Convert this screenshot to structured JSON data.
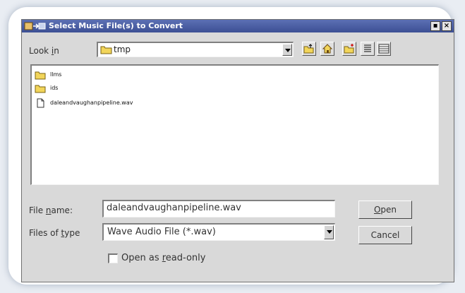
{
  "dialog": {
    "title": "Select Music File(s) to Convert",
    "title_buttons": [
      "▪",
      "×"
    ]
  },
  "look_in": {
    "label_pre": "Look ",
    "label_ul": "i",
    "label_post": "n",
    "value": "tmp"
  },
  "toolbar": {
    "icons": [
      "up-folder-icon",
      "home-icon",
      "new-folder-icon",
      "list-view-icon",
      "detail-view-icon"
    ]
  },
  "files": [
    {
      "name": "llms",
      "type": "folder"
    },
    {
      "name": "ids",
      "type": "folder"
    },
    {
      "name": "daleandvaughanpipeline.wav",
      "type": "file"
    }
  ],
  "file_name": {
    "label_pre": "File ",
    "label_ul": "n",
    "label_post": "ame:",
    "value": "daleandvaughanpipeline.wav"
  },
  "file_type": {
    "label_pre": "Files of ",
    "label_ul": "t",
    "label_post": "ype",
    "value": "Wave Audio File (*.wav)"
  },
  "buttons": {
    "open_ul": "O",
    "open_post": "pen",
    "cancel": "Cancel"
  },
  "read_only": {
    "label_pre": "Open as ",
    "label_ul": "r",
    "label_post": "ead-only",
    "checked": false
  },
  "colors": {
    "titlebar": "#3c4f94",
    "window": "#d9d9d9",
    "folder": "#f2d55a"
  }
}
